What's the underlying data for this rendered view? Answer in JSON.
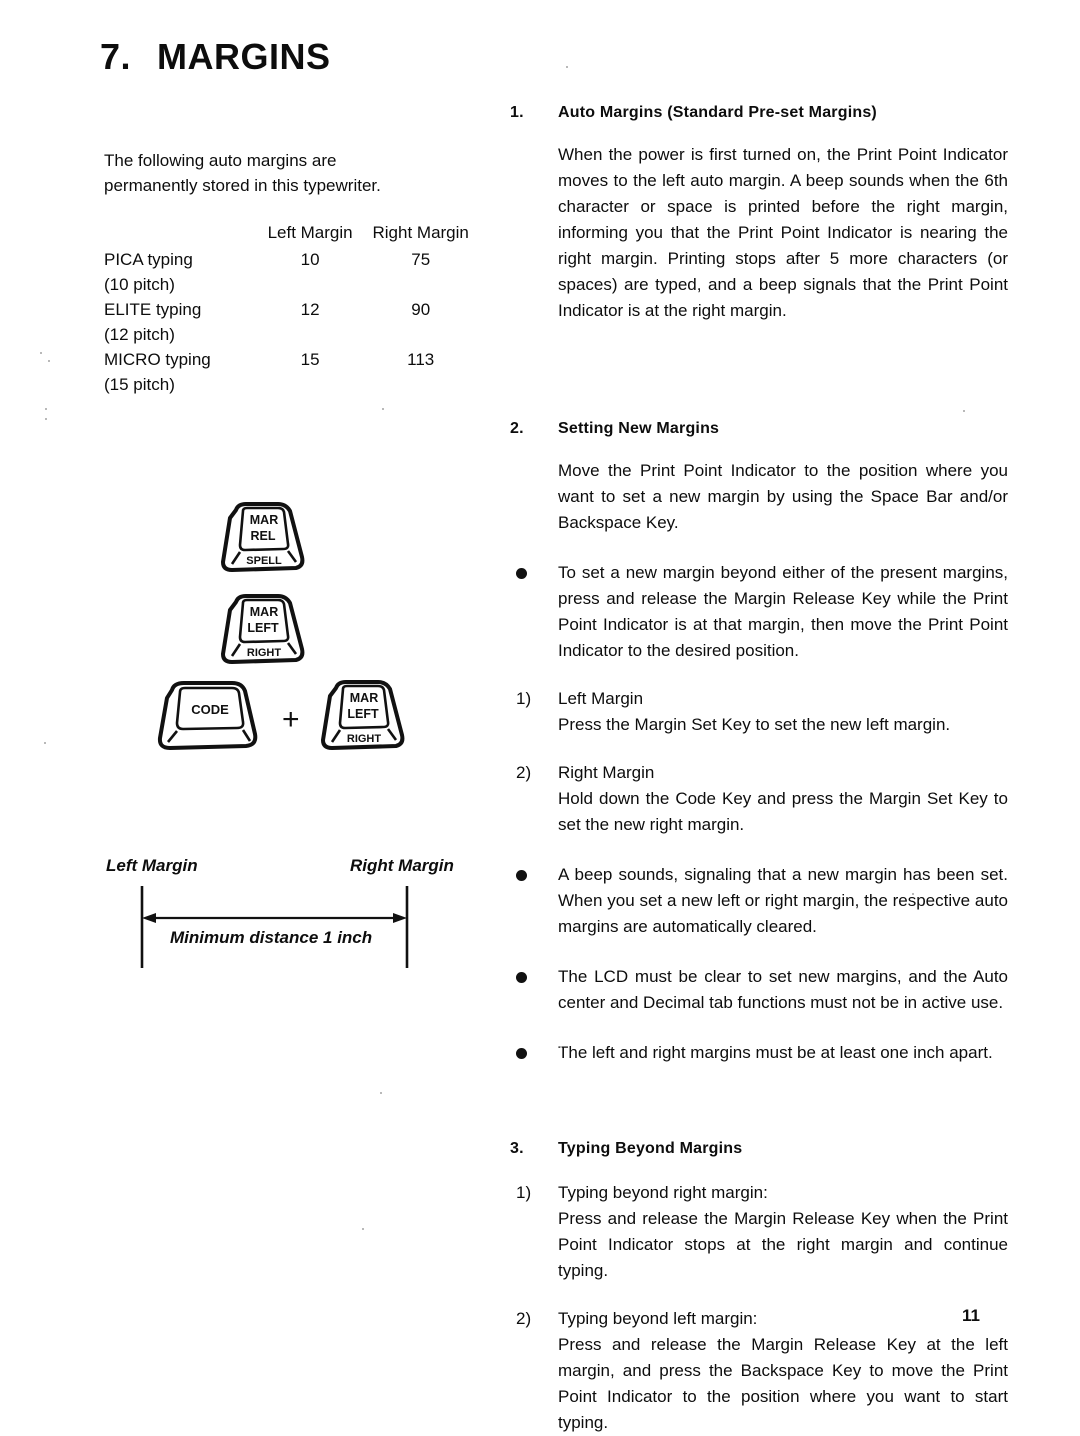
{
  "title": {
    "number": "7.",
    "text": "MARGINS"
  },
  "left_column": {
    "intro_lines": [
      "The following auto margins are",
      "permanently stored in this typewriter."
    ],
    "table": {
      "headers": [
        "",
        "Left Margin",
        "Right Margin"
      ],
      "rows": [
        {
          "name": "PICA typing",
          "pitch": "(10 pitch)",
          "left": "10",
          "right": "75"
        },
        {
          "name": "ELITE typing",
          "pitch": "(12 pitch)",
          "left": "12",
          "right": "90"
        },
        {
          "name": "MICRO typing",
          "pitch": "(15 pitch)",
          "left": "15",
          "right": "113"
        }
      ]
    },
    "keys": {
      "margin_release": {
        "top": "MAR",
        "mid": "REL",
        "skirt": "SPELL"
      },
      "margin_set": {
        "top": "MAR",
        "mid": "LEFT",
        "skirt": "RIGHT"
      },
      "code": {
        "label": "CODE"
      },
      "combo_operator": "+",
      "code_combo": {
        "top": "MAR",
        "mid": "LEFT",
        "skirt": "RIGHT"
      }
    },
    "diagram": {
      "left_label": "Left Margin",
      "right_label": "Right Margin",
      "caption": "Minimum distance 1 inch"
    }
  },
  "right_column": {
    "sections": [
      {
        "number": "1.",
        "heading": "Auto Margins (Standard Pre-set Margins)",
        "body": "When the power is first turned on, the Print Point Indicator moves to the left auto margin. A beep sounds when the 6th character or space is printed before the right margin, informing you that the Print Point Indicator is nearing the right margin. Printing stops after 5 more characters (or spaces) are typed, and a beep signals that the Print Point Indicator is at the right margin."
      },
      {
        "number": "2.",
        "heading": "Setting New Margins",
        "body": "Move the Print Point Indicator to the position where you want to set a new margin by using the Space Bar and/or Backspace Key.",
        "bullet1": "To set a new margin beyond either of the present margins, press and release the Margin Release Key while the Print Point Indicator is at that margin, then move the Print Point Indicator to the desired position.",
        "item1_num": "1)",
        "item1_lead": "Left Margin",
        "item1_body": "Press the Margin Set Key to set the new left margin.",
        "item2_num": "2)",
        "item2_lead": "Right Margin",
        "item2_body": "Hold down the Code Key and press the Margin Set Key to set the new right margin.",
        "bullet2": "A beep sounds, signaling that a new margin has been set. When you set a new left or right margin, the respective auto margins are automatically cleared.",
        "bullet3": "The LCD must be clear to set new margins, and the Auto center and Decimal tab functions must not be in active use.",
        "bullet4": "The left and right margins must be at least one inch apart."
      },
      {
        "number": "3.",
        "heading": "Typing Beyond Margins",
        "item1_num": "1)",
        "item1_lead": "Typing beyond right margin:",
        "item1_body": "Press and release the Margin Release Key when the Print Point Indicator stops at the right margin and continue typing.",
        "item2_num": "2)",
        "item2_lead": "Typing beyond left margin:",
        "item2_body": "Press and release the Margin Release Key at the left margin, and press the Backspace Key to move the Print Point Indicator to the position where you want to start typing."
      }
    ]
  },
  "footer": {
    "page_number": "11"
  }
}
